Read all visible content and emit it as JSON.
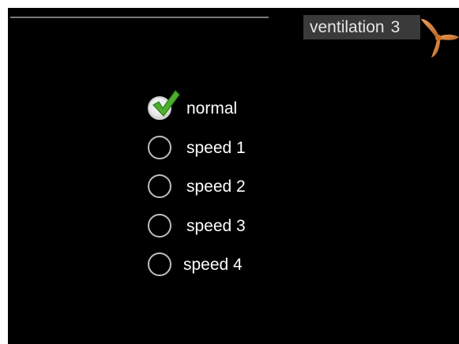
{
  "header": {
    "title": "ventilation",
    "number": "3",
    "icon": "fan-icon"
  },
  "menu": {
    "selected_index": 0,
    "options": [
      {
        "label": "normal",
        "checked": true
      },
      {
        "label": "speed 1",
        "checked": false
      },
      {
        "label": "speed 2",
        "checked": false
      },
      {
        "label": "speed 3",
        "checked": false
      },
      {
        "label": "speed 4",
        "checked": false
      }
    ]
  },
  "colors": {
    "background": "#000000",
    "text": "#ffffff",
    "title_box": "#3a3a3a",
    "fan": "#d9823a",
    "check": "#4cae2c"
  }
}
